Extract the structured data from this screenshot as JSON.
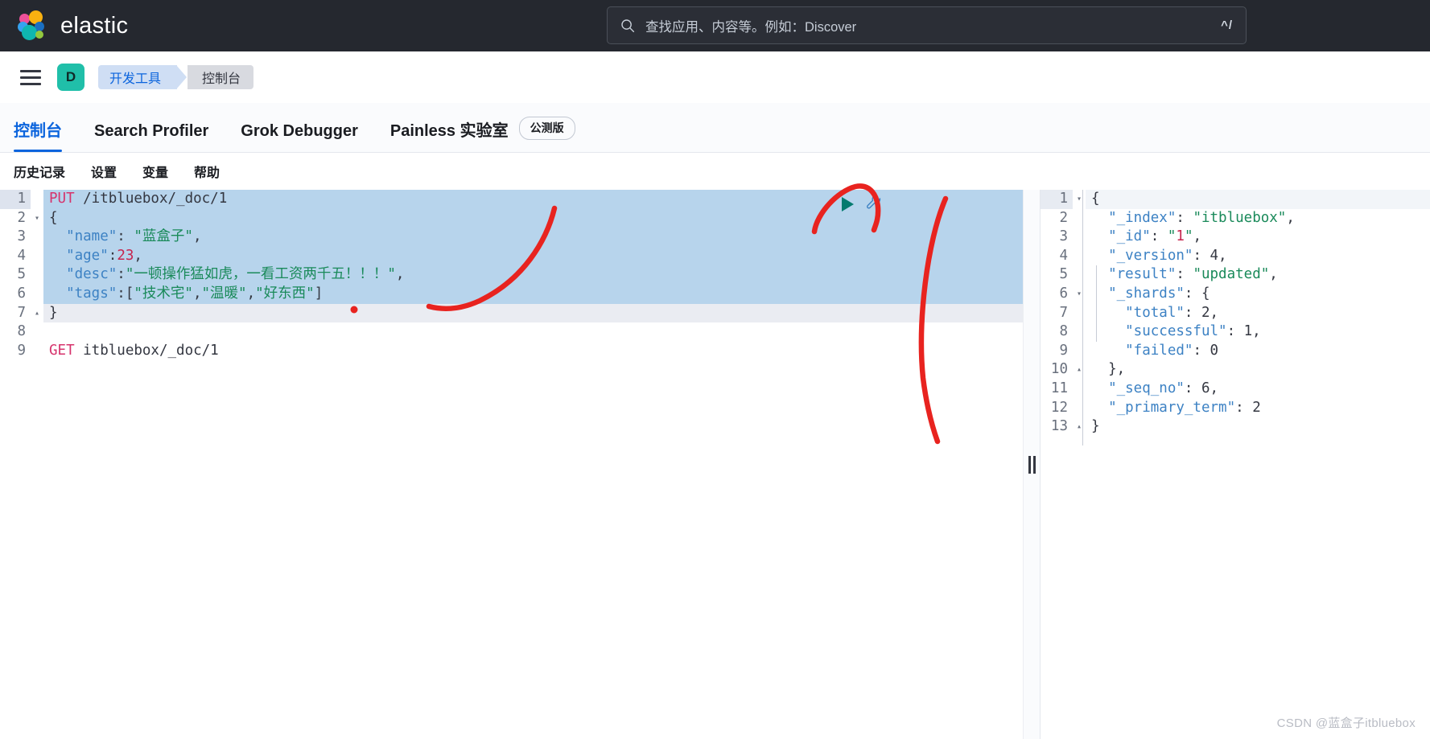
{
  "header": {
    "brand": "elastic",
    "brand_logo_icon": "elastic-logo-icon",
    "search": {
      "icon": "search-icon",
      "placeholder": "查找应用、内容等。例如：Discover",
      "value": "",
      "shortcut_hint": "^/"
    }
  },
  "breadcrumb": {
    "menu_icon": "hamburger-menu-icon",
    "space_avatar": "D",
    "items": [
      {
        "label": "开发工具"
      },
      {
        "label": "控制台"
      }
    ]
  },
  "tabs": [
    {
      "label": "控制台",
      "active": true
    },
    {
      "label": "Search Profiler",
      "active": false
    },
    {
      "label": "Grok Debugger",
      "active": false
    },
    {
      "label": "Painless 实验室",
      "active": false,
      "badge": "公测版"
    }
  ],
  "subnav": [
    {
      "label": "历史记录"
    },
    {
      "label": "设置"
    },
    {
      "label": "变量"
    },
    {
      "label": "帮助"
    }
  ],
  "editor": {
    "play_icon": "play-triangle-icon",
    "wrench_icon": "wrench-icon",
    "lines": [
      {
        "n": 1,
        "fold": "",
        "state": "active",
        "tokens": [
          {
            "c": "t-method",
            "t": "PUT"
          },
          {
            "c": "t-url",
            "t": " /itbluebox/_doc/1"
          }
        ]
      },
      {
        "n": 2,
        "fold": "▾",
        "state": "sel",
        "tokens": [
          {
            "c": "t-punc",
            "t": "{"
          }
        ]
      },
      {
        "n": 3,
        "fold": "",
        "state": "sel",
        "tokens": [
          {
            "c": "t-key",
            "t": "  \"name\""
          },
          {
            "c": "t-punc",
            "t": ": "
          },
          {
            "c": "t-str",
            "t": "\"蓝盒子\""
          },
          {
            "c": "t-punc",
            "t": ","
          }
        ]
      },
      {
        "n": 4,
        "fold": "",
        "state": "sel",
        "tokens": [
          {
            "c": "t-key",
            "t": "  \"age\""
          },
          {
            "c": "t-punc",
            "t": ":"
          },
          {
            "c": "t-num",
            "t": "23"
          },
          {
            "c": "t-punc",
            "t": ","
          }
        ]
      },
      {
        "n": 5,
        "fold": "",
        "state": "sel",
        "tokens": [
          {
            "c": "t-key",
            "t": "  \"desc\""
          },
          {
            "c": "t-punc",
            "t": ":"
          },
          {
            "c": "t-str",
            "t": "\"一顿操作猛如虎，一看工资两千五！！！\""
          },
          {
            "c": "t-punc",
            "t": ","
          }
        ]
      },
      {
        "n": 6,
        "fold": "",
        "state": "sel",
        "tokens": [
          {
            "c": "t-key",
            "t": "  \"tags\""
          },
          {
            "c": "t-punc",
            "t": ":["
          },
          {
            "c": "t-str",
            "t": "\"技术宅\""
          },
          {
            "c": "t-punc",
            "t": ","
          },
          {
            "c": "t-str",
            "t": "\"温暖\""
          },
          {
            "c": "t-punc",
            "t": ","
          },
          {
            "c": "t-str",
            "t": "\"好东西\""
          },
          {
            "c": "t-punc",
            "t": "]"
          }
        ]
      },
      {
        "n": 7,
        "fold": "▴",
        "state": "softline",
        "tokens": [
          {
            "c": "t-punc",
            "t": "}"
          }
        ]
      },
      {
        "n": 8,
        "fold": "",
        "state": "",
        "tokens": [
          {
            "c": "t-punc",
            "t": ""
          }
        ]
      },
      {
        "n": 9,
        "fold": "",
        "state": "",
        "tokens": [
          {
            "c": "t-method",
            "t": "GET"
          },
          {
            "c": "t-url",
            "t": " itbluebox/_doc/1"
          }
        ]
      }
    ]
  },
  "response": {
    "lines": [
      {
        "n": 1,
        "fold": "▾",
        "state": "resp-active",
        "tokens": [
          {
            "c": "t-punc",
            "t": "{"
          }
        ]
      },
      {
        "n": 2,
        "fold": "",
        "state": "",
        "tokens": [
          {
            "c": "t-key",
            "t": "  \"_index\""
          },
          {
            "c": "t-punc",
            "t": ": "
          },
          {
            "c": "t-str",
            "t": "\"itbluebox\""
          },
          {
            "c": "t-punc",
            "t": ","
          }
        ]
      },
      {
        "n": 3,
        "fold": "",
        "state": "",
        "tokens": [
          {
            "c": "t-key",
            "t": "  \"_id\""
          },
          {
            "c": "t-punc",
            "t": ": "
          },
          {
            "c": "t-str",
            "t": "\""
          },
          {
            "c": "t-num",
            "t": "1"
          },
          {
            "c": "t-str",
            "t": "\""
          },
          {
            "c": "t-punc",
            "t": ","
          }
        ]
      },
      {
        "n": 4,
        "fold": "",
        "state": "",
        "tokens": [
          {
            "c": "t-key",
            "t": "  \"_version\""
          },
          {
            "c": "t-punc",
            "t": ": "
          },
          {
            "c": "t-punc",
            "t": "4,"
          }
        ]
      },
      {
        "n": 5,
        "fold": "",
        "state": "",
        "tokens": [
          {
            "c": "t-key",
            "t": "  \"result\""
          },
          {
            "c": "t-punc",
            "t": ": "
          },
          {
            "c": "t-str",
            "t": "\"updated\""
          },
          {
            "c": "t-punc",
            "t": ","
          }
        ]
      },
      {
        "n": 6,
        "fold": "▾",
        "state": "",
        "tokens": [
          {
            "c": "t-key",
            "t": "  \"_shards\""
          },
          {
            "c": "t-punc",
            "t": ": {"
          }
        ]
      },
      {
        "n": 7,
        "fold": "",
        "state": "",
        "tokens": [
          {
            "c": "t-key",
            "t": "    \"total\""
          },
          {
            "c": "t-punc",
            "t": ": 2,"
          }
        ]
      },
      {
        "n": 8,
        "fold": "",
        "state": "",
        "tokens": [
          {
            "c": "t-key",
            "t": "    \"successful\""
          },
          {
            "c": "t-punc",
            "t": ": 1,"
          }
        ]
      },
      {
        "n": 9,
        "fold": "",
        "state": "",
        "tokens": [
          {
            "c": "t-key",
            "t": "    \"failed\""
          },
          {
            "c": "t-punc",
            "t": ": 0"
          }
        ]
      },
      {
        "n": 10,
        "fold": "▴",
        "state": "",
        "tokens": [
          {
            "c": "t-punc",
            "t": "  },"
          }
        ]
      },
      {
        "n": 11,
        "fold": "",
        "state": "",
        "tokens": [
          {
            "c": "t-key",
            "t": "  \"_seq_no\""
          },
          {
            "c": "t-punc",
            "t": ": 6,"
          }
        ]
      },
      {
        "n": 12,
        "fold": "",
        "state": "",
        "tokens": [
          {
            "c": "t-key",
            "t": "  \"_primary_term\""
          },
          {
            "c": "t-punc",
            "t": ": 2"
          }
        ]
      },
      {
        "n": 13,
        "fold": "▴",
        "state": "",
        "tokens": [
          {
            "c": "t-punc",
            "t": "}"
          }
        ]
      }
    ]
  },
  "splitter": {
    "label": "resize-handle"
  },
  "watermark": "CSDN @蓝盒子itbluebox",
  "colors": {
    "topbar_bg": "#25282f",
    "accent_blue": "#0b64dd",
    "avatar_teal": "#20bfa9",
    "selection_blue": "#b7d4ec",
    "annotation_red": "#e8231f",
    "play_green": "#047b6f"
  }
}
